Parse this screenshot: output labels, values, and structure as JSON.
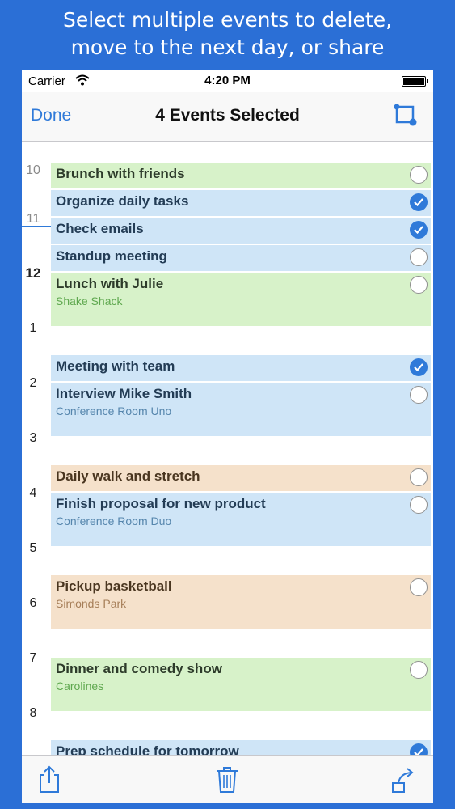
{
  "caption": {
    "line1": "Select multiple events to delete,",
    "line2": "move to the next day, or share"
  },
  "status_bar": {
    "carrier": "Carrier",
    "time": "4:20 PM"
  },
  "nav": {
    "done_label": "Done",
    "title": "4 Events Selected"
  },
  "hours": [
    "10",
    "11",
    "12",
    "1",
    "2",
    "3",
    "4",
    "5",
    "6",
    "7",
    "8"
  ],
  "events": [
    {
      "title": "Brunch with friends",
      "location": "",
      "color": "green",
      "selected": false
    },
    {
      "title": "Organize daily tasks",
      "location": "",
      "color": "blue",
      "selected": true
    },
    {
      "title": "Check emails",
      "location": "",
      "color": "blue",
      "selected": true
    },
    {
      "title": "Standup meeting",
      "location": "",
      "color": "blue",
      "selected": false
    },
    {
      "title": "Lunch with Julie",
      "location": "Shake Shack",
      "color": "green",
      "selected": false
    },
    {
      "title": "Meeting with team",
      "location": "",
      "color": "blue",
      "selected": true
    },
    {
      "title": "Interview Mike Smith",
      "location": "Conference Room Uno",
      "color": "blue",
      "selected": false
    },
    {
      "title": "Daily walk and stretch",
      "location": "",
      "color": "orange",
      "selected": false
    },
    {
      "title": "Finish proposal for new product",
      "location": "Conference Room Duo",
      "color": "blue",
      "selected": false
    },
    {
      "title": "Pickup basketball",
      "location": "Simonds Park",
      "color": "orange",
      "selected": false
    },
    {
      "title": "Dinner and comedy show",
      "location": "Carolines",
      "color": "green",
      "selected": false
    },
    {
      "title": "Prep schedule for tomorrow",
      "location": "",
      "color": "blue",
      "selected": true
    }
  ],
  "toolbar": {
    "icons": [
      "share-icon",
      "trash-icon",
      "move-to-next-day-icon"
    ]
  },
  "colors": {
    "accent": "#2f7ad9",
    "background": "#2b6fd6",
    "event_green": "#d7f2c9",
    "event_blue": "#cfe5f7",
    "event_orange": "#f5e1cb"
  }
}
